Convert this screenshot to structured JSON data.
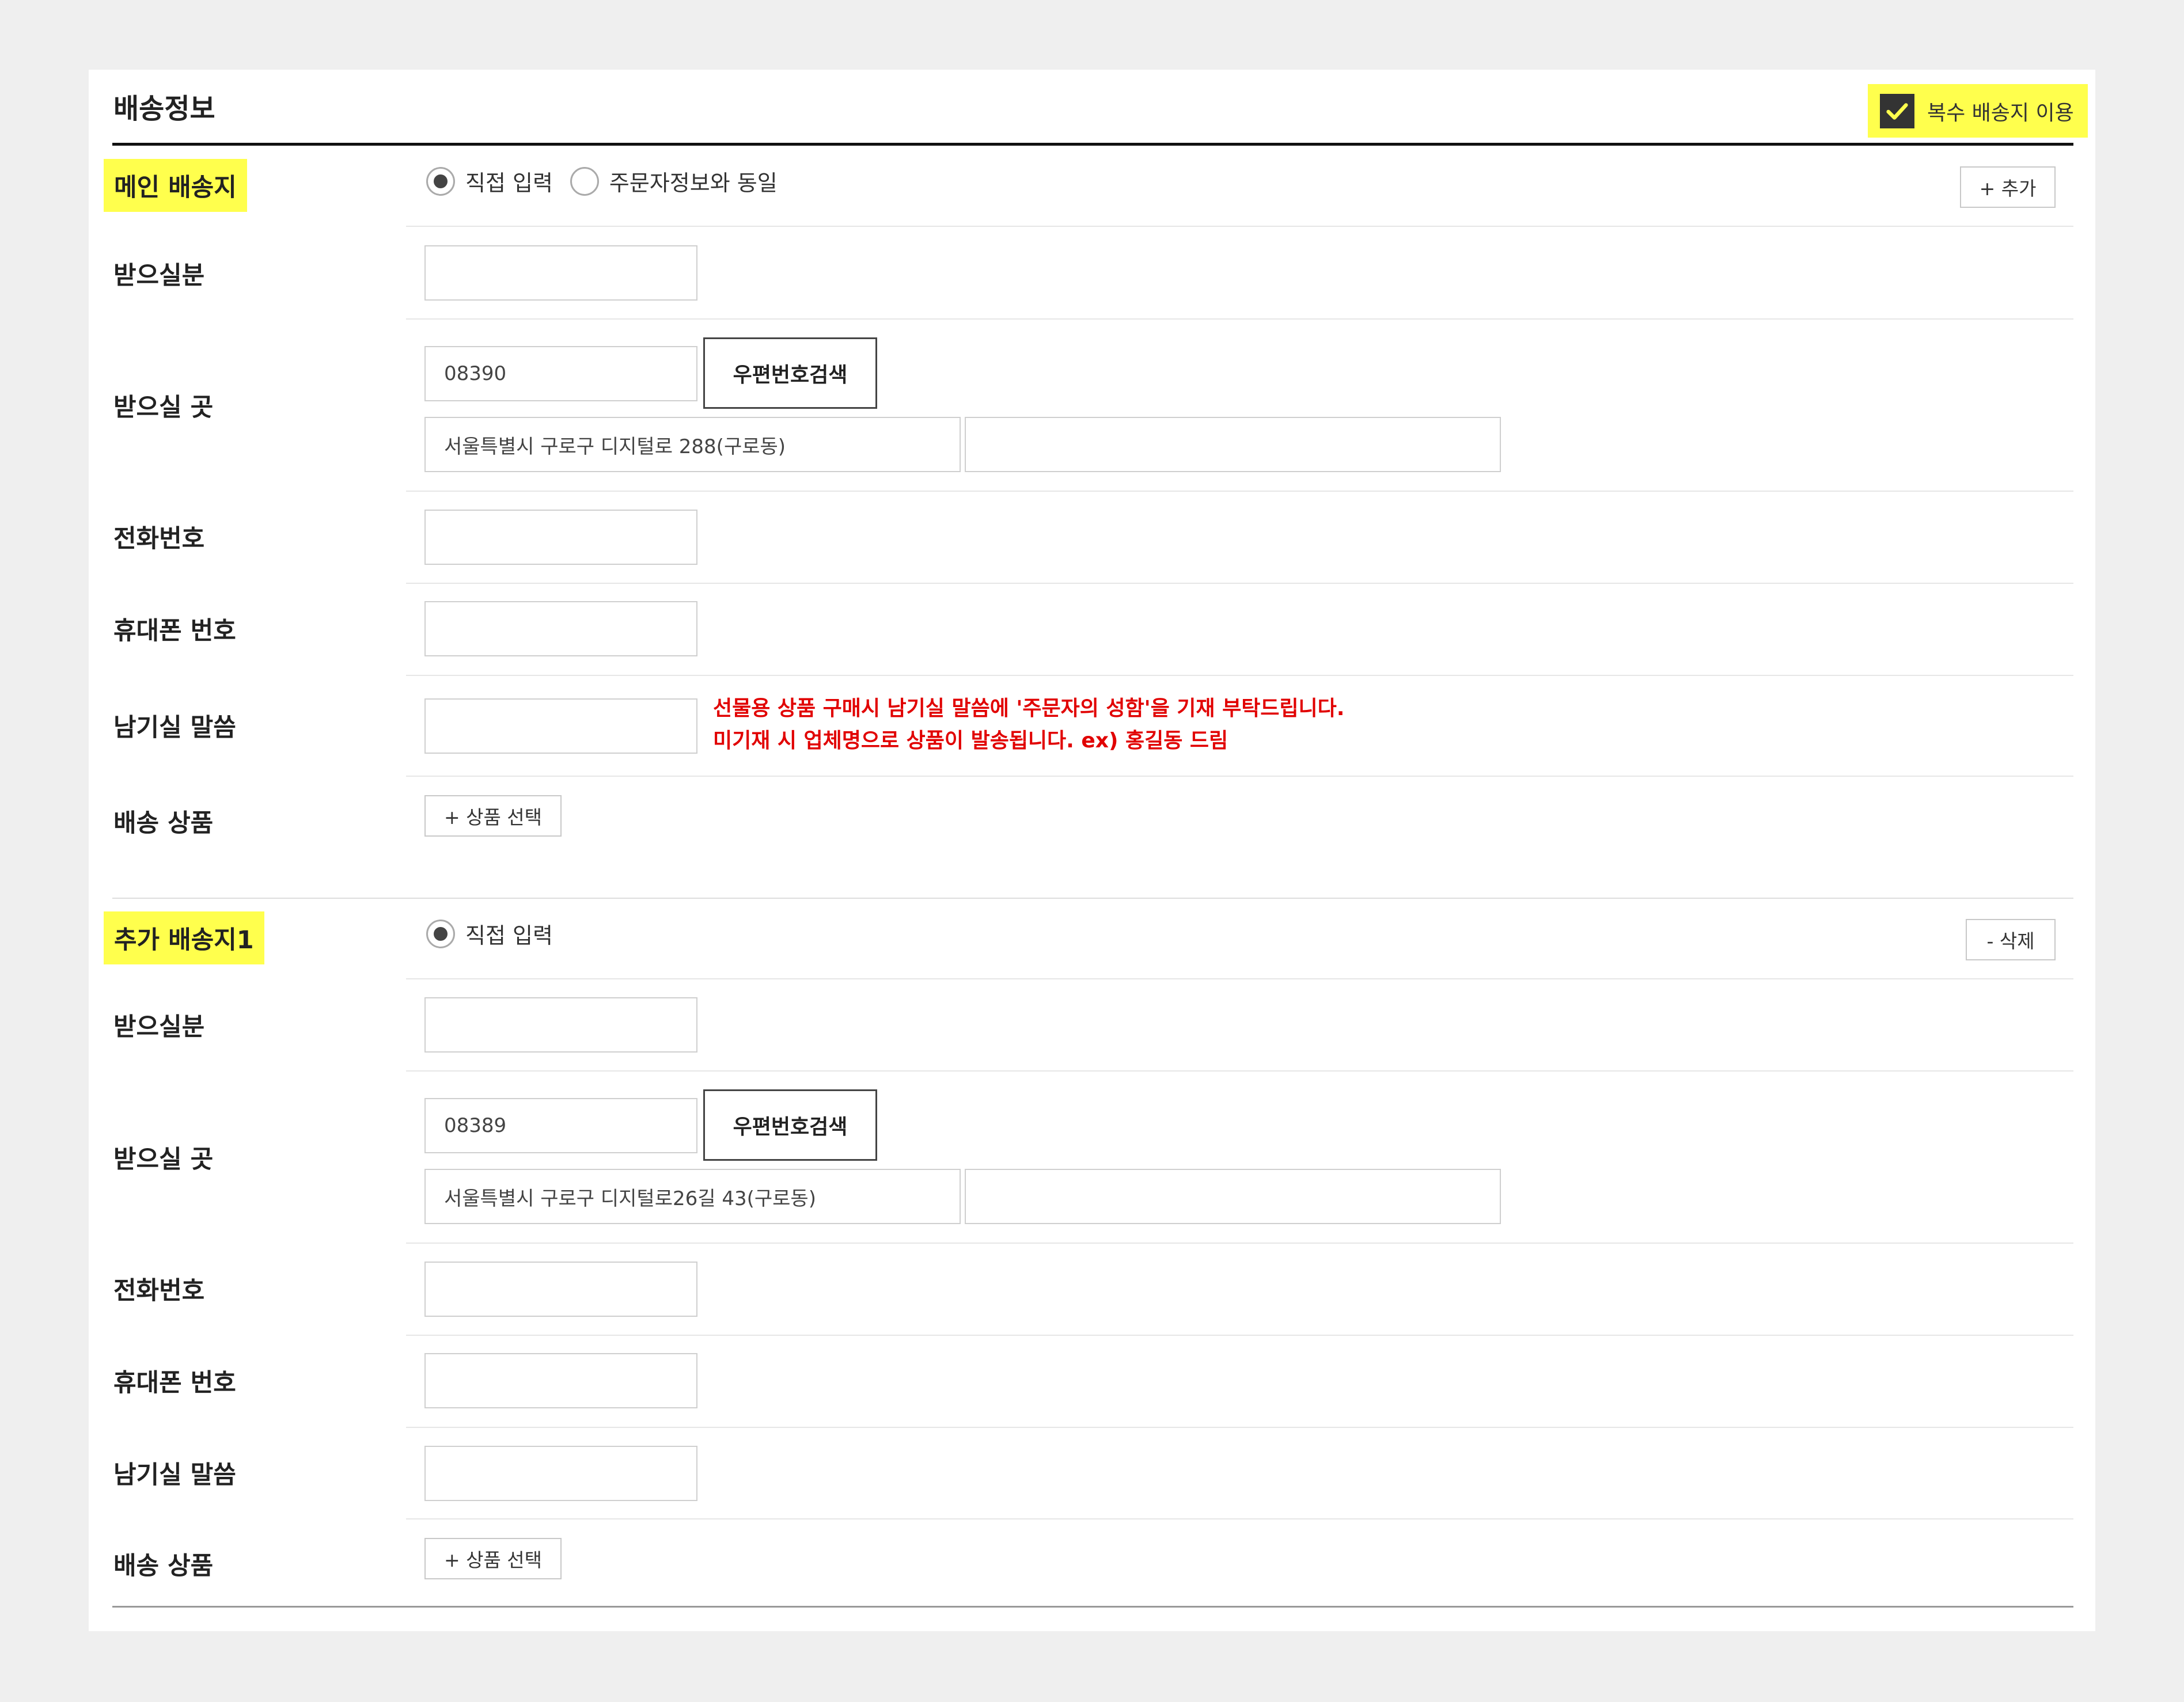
{
  "header": {
    "title": "배송정보",
    "multi_address_label": "복수 배송지 이용",
    "multi_address_checked": true
  },
  "main_section": {
    "label": "메인 배송지",
    "radio_options": [
      "직접 입력",
      "주문자정보와 동일"
    ],
    "selected_option": "직접 입력",
    "add_button": "+ 추가",
    "fields": {
      "recipient_label": "받으실분",
      "recipient_value": "",
      "address_label": "받으실 곳",
      "zipcode": "08390",
      "zip_search_button": "우편번호검색",
      "address1": "서울특별시 구로구 디지털로 288(구로동)",
      "address2": "",
      "phone_label": "전화번호",
      "phone_value": "",
      "mobile_label": "휴대폰 번호",
      "mobile_value": "",
      "message_label": "남기실 말씀",
      "message_value": "",
      "message_note_line1": "선물용 상품 구매시 남기실 말씀에 '주문자의 성함'을 기재 부탁드립니다.",
      "message_note_line2": "미기재 시 업체명으로 상품이 발송됩니다. ex) 홍길동 드림",
      "product_label": "배송 상품",
      "product_select_button": "+ 상품 선택"
    }
  },
  "extra_section": {
    "label": "추가 배송지1",
    "radio_options": [
      "직접 입력"
    ],
    "selected_option": "직접 입력",
    "delete_button": "- 삭제",
    "fields": {
      "recipient_label": "받으실분",
      "recipient_value": "",
      "address_label": "받으실 곳",
      "zipcode": "08389",
      "zip_search_button": "우편번호검색",
      "address1": "서울특별시 구로구 디지털로26길 43(구로동)",
      "address2": "",
      "phone_label": "전화번호",
      "phone_value": "",
      "mobile_label": "휴대폰 번호",
      "mobile_value": "",
      "message_label": "남기실 말씀",
      "message_value": "",
      "product_label": "배송 상품",
      "product_select_button": "+ 상품 선택"
    }
  },
  "colors": {
    "highlight": "#ffff4d",
    "note_red": "#e10000",
    "checkbox_bg": "#333333"
  }
}
